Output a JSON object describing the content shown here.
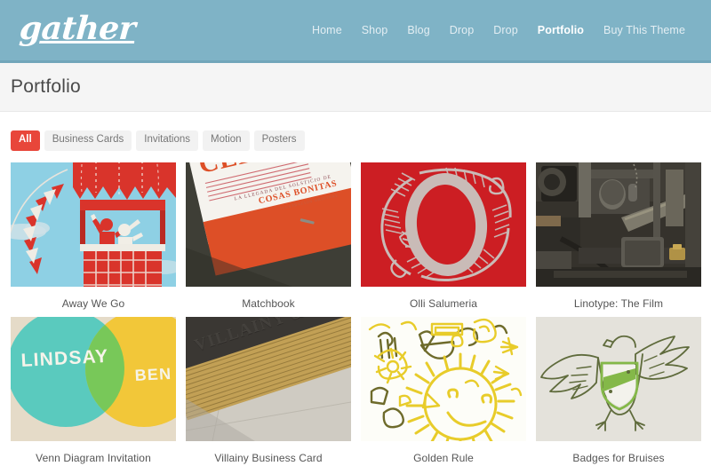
{
  "header": {
    "logo_text": "gather",
    "bg_color": "#7fb3c6",
    "nav": [
      {
        "label": "Home",
        "active": false
      },
      {
        "label": "Shop",
        "active": false
      },
      {
        "label": "Blog",
        "active": false
      },
      {
        "label": "Drop",
        "active": false
      },
      {
        "label": "Drop",
        "active": false
      },
      {
        "label": "Portfolio",
        "active": true
      },
      {
        "label": "Buy This Theme",
        "active": false
      }
    ]
  },
  "page": {
    "title": "Portfolio"
  },
  "filters": {
    "active_color": "#e8463a",
    "items": [
      {
        "label": "All",
        "active": true
      },
      {
        "label": "Business Cards",
        "active": false
      },
      {
        "label": "Invitations",
        "active": false
      },
      {
        "label": "Motion",
        "active": false
      },
      {
        "label": "Posters",
        "active": false
      }
    ]
  },
  "portfolio": {
    "items": [
      {
        "caption": "Away We Go",
        "artwork": "hot-air-balloon",
        "colors": {
          "sky": "#8ed0e4",
          "red": "#d9342b",
          "white": "#f2f0ea"
        },
        "text": []
      },
      {
        "caption": "Matchbook",
        "artwork": "matchbook-celebra",
        "colors": {
          "bg": "#3b3b33",
          "paper": "#f4f2ef",
          "orange": "#e0502a"
        },
        "text": [
          "CELEBRA",
          "LA LLEGADA DEL SOLSTICIO DE",
          "COSAS BONITAS"
        ]
      },
      {
        "caption": "Olli Salumeria",
        "artwork": "ornate-letter-o",
        "colors": {
          "bg": "#cc1f23",
          "ink": "#c9c9c4"
        },
        "text": [
          "O"
        ]
      },
      {
        "caption": "Linotype: The Film",
        "artwork": "linotype-machine",
        "colors": {
          "dark": "#2b2824",
          "metal": "#6e6a60",
          "brass": "#b79a46"
        },
        "text": []
      },
      {
        "caption": "Venn Diagram Invitation",
        "artwork": "venn-diagram",
        "colors": {
          "teal": "#54c8bc",
          "yellow": "#f2c531",
          "overlap": "#73c653",
          "paper": "#e4dac6"
        },
        "text": [
          "LINDSAY",
          "BEN"
        ]
      },
      {
        "caption": "Villainy Business Card",
        "artwork": "gilded-business-cards",
        "colors": {
          "card": "#3a3733",
          "gold": "#c4a051",
          "bg": "#cfcbc2"
        },
        "text": [
          "VILLAINY & ASSOCIATES"
        ]
      },
      {
        "caption": "Golden Rule",
        "artwork": "sun-doodles",
        "colors": {
          "paper": "#fdfdf8",
          "yellow": "#e8cc2a",
          "olive": "#6e6b2b"
        },
        "text": []
      },
      {
        "caption": "Badges for Bruises",
        "artwork": "eagle-crest",
        "colors": {
          "paper": "#e9e7e0",
          "ink": "#5f6b3c",
          "green": "#84b849"
        },
        "text": []
      }
    ]
  }
}
